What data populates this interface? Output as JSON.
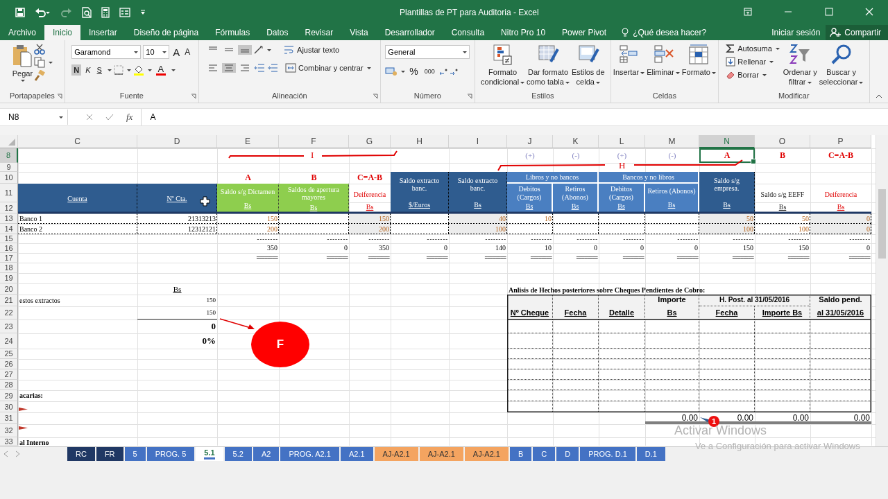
{
  "window": {
    "title": "Plantillas de PT para Auditoria - Excel"
  },
  "menu": {
    "tabs": [
      {
        "label": "Archivo",
        "selected": false
      },
      {
        "label": "Inicio",
        "selected": true
      },
      {
        "label": "Insertar",
        "selected": false
      },
      {
        "label": "Diseño de página",
        "selected": false
      },
      {
        "label": "Fórmulas",
        "selected": false
      },
      {
        "label": "Datos",
        "selected": false
      },
      {
        "label": "Revisar",
        "selected": false
      },
      {
        "label": "Vista",
        "selected": false
      },
      {
        "label": "Desarrollador",
        "selected": false
      },
      {
        "label": "Consulta",
        "selected": false
      },
      {
        "label": "Nitro Pro 10",
        "selected": false
      },
      {
        "label": "Power Pivot",
        "selected": false
      }
    ],
    "tell_me": "¿Qué desea hacer?",
    "sign_in": "Iniciar sesión",
    "share": "Compartir"
  },
  "ribbon": {
    "groups": [
      {
        "kind": "clipboard",
        "label": "Portapapeles",
        "paste": "Pegar"
      },
      {
        "kind": "font",
        "label": "Fuente",
        "font": "Garamond",
        "size": "10",
        "grow": "A",
        "shrink": "A",
        "font_color_label": "A",
        "toggles": [
          {
            "label": "N",
            "on": true
          },
          {
            "label": "K",
            "on": false
          },
          {
            "label": "S",
            "on": false
          }
        ]
      },
      {
        "kind": "alignment",
        "label": "Alineación",
        "wrap": "Ajustar texto",
        "merge": "Combinar y centrar",
        "vertical": [
          {
            "on": false
          },
          {
            "on": false
          },
          {
            "on": true
          }
        ],
        "horizontal": [
          {
            "on": false
          },
          {
            "on": true
          },
          {
            "on": false
          }
        ]
      },
      {
        "kind": "number",
        "label": "Número",
        "format": "General",
        "percent": "%",
        "thousands": "000"
      },
      {
        "kind": "large",
        "label": "Estilos",
        "buttons": [
          {
            "lines": [
              "Formato",
              "condicional"
            ]
          },
          {
            "lines": [
              "Dar formato",
              "como tabla"
            ]
          },
          {
            "lines": [
              "Estilos de",
              "celda"
            ]
          }
        ]
      },
      {
        "kind": "large",
        "label": "Celdas",
        "buttons": [
          {
            "lines": [
              "Insertar"
            ]
          },
          {
            "lines": [
              "Eliminar"
            ]
          },
          {
            "lines": [
              "Formato"
            ]
          }
        ]
      },
      {
        "kind": "editing",
        "label": "Modificar",
        "small": [
          "Autosuma",
          "Rellenar",
          "Borrar"
        ],
        "buttons": [
          {
            "lines": [
              "Ordenar y",
              "filtrar"
            ]
          },
          {
            "lines": [
              "Buscar y",
              "seleccionar"
            ]
          }
        ]
      }
    ]
  },
  "formula_bar": {
    "name_box": "N8",
    "fx": "fx",
    "value": "A"
  },
  "sheet": {
    "columns": [
      {
        "label": "C",
        "selected": false
      },
      {
        "label": "D",
        "selected": false
      },
      {
        "label": "E",
        "selected": false
      },
      {
        "label": "F",
        "selected": false
      },
      {
        "label": "G",
        "selected": false
      },
      {
        "label": "H",
        "selected": false
      },
      {
        "label": "I",
        "selected": false
      },
      {
        "label": "J",
        "selected": false
      },
      {
        "label": "K",
        "selected": false
      },
      {
        "label": "L",
        "selected": false
      },
      {
        "label": "M",
        "selected": false
      },
      {
        "label": "N",
        "selected": true
      },
      {
        "label": "O",
        "selected": false
      },
      {
        "label": "P",
        "selected": false
      }
    ],
    "rows": [
      {
        "number": "8",
        "selected": true,
        "cells": [
          null,
          null,
          null,
          null,
          null,
          null,
          null,
          {
            "kind": "sign",
            "text": "(+)"
          },
          {
            "kind": "sign",
            "text": "(-)"
          },
          {
            "kind": "sign",
            "text": "(+)"
          },
          {
            "kind": "sign",
            "text": "(-)"
          },
          {
            "kind": "red-title",
            "text": "A"
          },
          {
            "kind": "red-title",
            "text": "B"
          },
          {
            "kind": "red-title",
            "text": "C=A-B"
          }
        ]
      },
      {
        "number": "9",
        "selected": false
      },
      {
        "number": "10",
        "selected": false,
        "cells": [
          null,
          null,
          {
            "kind": "red-title",
            "text": "A"
          },
          {
            "kind": "red-title",
            "text": "B"
          },
          {
            "kind": "red-title",
            "text": "C=A-B"
          },
          {
            "kind": "hdr",
            "text": "Saldo extracto banc.",
            "unit": "$/Euros"
          },
          {
            "kind": "hdr",
            "text": "Saldo extracto banc.",
            "unit": "Bs"
          },
          {
            "kind": "hdr-light",
            "text": "Libros y no bancos"
          },
          {
            "kind": "merged-left"
          },
          {
            "kind": "hdr-light",
            "text": "Bancos y no libros"
          },
          {
            "kind": "merged-left"
          },
          {
            "kind": "hdr",
            "text": "Saldo s/g empresa.",
            "unit": "Bs"
          }
        ]
      },
      {
        "number": "11",
        "selected": false,
        "cells": [
          {
            "kind": "hdr",
            "unit": "Cuenta"
          },
          {
            "kind": "hdr",
            "unit": "Nº Cta."
          },
          {
            "kind": "hdr-green",
            "text": "Saldo s/g Dictamen",
            "unit": "Bs"
          },
          {
            "kind": "hdr-green",
            "text": "Saldos de apertura mayores",
            "unit": "Bs"
          },
          {
            "kind": "red-sub",
            "text": "Deiferencia",
            "unit": "Bs"
          },
          {
            "kind": "merged-up"
          },
          {
            "kind": "merged-up"
          },
          {
            "kind": "hdr-light",
            "text": "Debitos (Cargos)",
            "unit": "Bs"
          },
          {
            "kind": "hdr-light",
            "text": "Retiros (Abonos)",
            "unit": "Bs"
          },
          {
            "kind": "hdr-light",
            "text": "Debitos (Cargos)",
            "unit": "Bs"
          },
          {
            "kind": "hdr-light",
            "text": "Retiros (Abonos)",
            "unit": "Bs"
          },
          {
            "kind": "merged-up"
          },
          {
            "kind": "plain-sub",
            "text": "Saldo s/g EEFF",
            "unit": "Bs"
          },
          {
            "kind": "red-sub",
            "text": "Deiferencia",
            "unit": "Bs"
          }
        ]
      },
      {
        "number": "12",
        "selected": false,
        "cells": [
          {
            "kind": "merged-up"
          },
          {
            "kind": "merged-up"
          },
          {
            "kind": "merged-up"
          },
          {
            "kind": "merged-up"
          },
          {
            "kind": "merged-up"
          },
          {
            "kind": "merged-up"
          },
          {
            "kind": "merged-up"
          },
          {
            "kind": "merged-up"
          },
          {
            "kind": "merged-up"
          },
          {
            "kind": "merged-up"
          },
          {
            "kind": "merged-up"
          },
          {
            "kind": "merged-up"
          },
          {
            "kind": "merged-up"
          },
          {
            "kind": "merged-up"
          }
        ]
      },
      {
        "number": "13",
        "selected": false,
        "cells": [
          {
            "kind": "entry",
            "text": "Banco 1"
          },
          {
            "kind": "entry-num",
            "text": "21313213"
          },
          {
            "kind": "entry-amount",
            "text": "150"
          },
          null,
          {
            "kind": "entry-shaded",
            "text": "150"
          },
          null,
          {
            "kind": "entry-shaded",
            "text": "40"
          },
          {
            "kind": "entry-amount",
            "text": "10"
          },
          null,
          null,
          null,
          {
            "kind": "entry-shaded",
            "text": "50"
          },
          {
            "kind": "entry-amount",
            "text": "50"
          },
          {
            "kind": "entry-shaded",
            "text": "0"
          }
        ]
      },
      {
        "number": "14",
        "selected": false,
        "cells": [
          {
            "kind": "entry",
            "text": "Banco 2"
          },
          {
            "kind": "entry-num",
            "text": "12312121"
          },
          {
            "kind": "entry-amount",
            "text": "200"
          },
          null,
          {
            "kind": "entry-shaded",
            "text": "200"
          },
          null,
          {
            "kind": "entry-shaded",
            "text": "100"
          },
          null,
          null,
          null,
          null,
          {
            "kind": "entry-shaded",
            "text": "100"
          },
          {
            "kind": "entry-amount",
            "text": "100"
          },
          {
            "kind": "entry-shaded",
            "text": "0"
          }
        ]
      },
      {
        "number": "15",
        "selected": false,
        "cells": [
          null,
          null,
          {
            "kind": "rule",
            "text": "--------"
          },
          {
            "kind": "rule",
            "text": "--------"
          },
          {
            "kind": "rule",
            "text": "--------"
          },
          {
            "kind": "rule",
            "text": "--------"
          },
          {
            "kind": "rule",
            "text": "--------"
          },
          {
            "kind": "rule",
            "text": "--------"
          },
          {
            "kind": "rule",
            "text": "--------"
          },
          {
            "kind": "rule",
            "text": "--------"
          },
          {
            "kind": "rule",
            "text": "--------"
          },
          {
            "kind": "rule",
            "text": "--------"
          },
          {
            "kind": "rule",
            "text": "--------"
          },
          {
            "kind": "rule",
            "text": "--------"
          }
        ]
      },
      {
        "number": "16",
        "selected": false,
        "cells": [
          null,
          null,
          {
            "kind": "sum",
            "text": "350"
          },
          {
            "kind": "sum",
            "text": "0"
          },
          {
            "kind": "sum",
            "text": "350"
          },
          {
            "kind": "sum",
            "text": "0"
          },
          {
            "kind": "sum",
            "text": "140"
          },
          {
            "kind": "sum",
            "text": "10"
          },
          {
            "kind": "sum",
            "text": "0"
          },
          {
            "kind": "sum",
            "text": "0"
          },
          {
            "kind": "sum",
            "text": "0"
          },
          {
            "kind": "sum",
            "text": "150"
          },
          {
            "kind": "sum",
            "text": "150"
          },
          {
            "kind": "sum",
            "text": "0"
          }
        ]
      },
      {
        "number": "17",
        "selected": false,
        "cells": [
          null,
          null,
          {
            "kind": "rule",
            "text": "========"
          },
          {
            "kind": "rule",
            "text": "========"
          },
          {
            "kind": "rule",
            "text": "========"
          },
          {
            "kind": "rule",
            "text": "========"
          },
          {
            "kind": "rule",
            "text": "========"
          },
          {
            "kind": "rule",
            "text": "========"
          },
          {
            "kind": "rule",
            "text": "========"
          },
          {
            "kind": "rule",
            "text": "========"
          },
          {
            "kind": "rule",
            "text": "========"
          },
          {
            "kind": "rule",
            "text": "========"
          },
          {
            "kind": "rule",
            "text": "========"
          },
          {
            "kind": "rule",
            "text": "========"
          }
        ]
      },
      {
        "number": "18",
        "selected": false
      },
      {
        "number": "19",
        "selected": false
      },
      {
        "number": "20",
        "selected": false,
        "cells": [
          null,
          {
            "kind": "unit",
            "unit": "Bs"
          },
          null,
          null,
          null,
          null,
          null,
          {
            "kind": "caption",
            "text": "Anlisis de Hechos posteriores sobre Cheques Pendientes de Cobro:"
          }
        ]
      },
      {
        "number": "21",
        "selected": false,
        "cells": [
          {
            "kind": "text",
            "text": "estos extractos"
          },
          {
            "kind": "small-num",
            "text": "150"
          },
          null,
          null,
          null,
          null,
          null,
          {
            "kind": "th",
            "unit": "Nº Cheque"
          },
          {
            "kind": "th",
            "unit": "Fecha"
          },
          {
            "kind": "th",
            "unit": "Detalle"
          },
          {
            "kind": "th",
            "text": "Importe",
            "unit": "Bs"
          },
          {
            "kind": "th-group",
            "text": "H. Post. al 31/05/2016"
          },
          {
            "kind": "merged-left"
          },
          {
            "kind": "th",
            "text": "Saldo pend.",
            "unit": "al 31/05/2016"
          }
        ]
      },
      {
        "number": "22",
        "selected": false,
        "cells": [
          null,
          {
            "kind": "small-num-line",
            "text": "150"
          },
          null,
          null,
          null,
          null,
          null,
          {
            "kind": "merged-up"
          },
          {
            "kind": "merged-up"
          },
          {
            "kind": "merged-up"
          },
          {
            "kind": "merged-up"
          },
          {
            "kind": "th",
            "unit": "Fecha"
          },
          {
            "kind": "th",
            "unit": "Importe Bs"
          },
          {
            "kind": "merged-up"
          }
        ]
      },
      {
        "number": "23",
        "selected": false,
        "cells": [
          null,
          {
            "kind": "big",
            "text": "0"
          }
        ]
      },
      {
        "number": "24",
        "selected": false,
        "cells": [
          null,
          {
            "kind": "big",
            "text": "0%"
          }
        ]
      },
      {
        "number": "25",
        "selected": false
      },
      {
        "number": "26",
        "selected": false
      },
      {
        "number": "27",
        "selected": false
      },
      {
        "number": "28",
        "selected": false
      },
      {
        "number": "29",
        "selected": false,
        "cells": [
          {
            "kind": "bold",
            "text": "acarias:"
          }
        ]
      },
      {
        "number": "30",
        "selected": false
      },
      {
        "number": "31",
        "selected": false,
        "cells": [
          null,
          null,
          null,
          null,
          null,
          null,
          null,
          null,
          null,
          null,
          {
            "kind": "total",
            "text": "0.00"
          },
          {
            "kind": "total",
            "text": "0.00"
          },
          {
            "kind": "total",
            "text": "0.00"
          },
          {
            "kind": "total",
            "text": "0.00"
          }
        ]
      },
      {
        "number": "32",
        "selected": false
      },
      {
        "number": "33",
        "selected": false,
        "cells": [
          {
            "kind": "bold",
            "text": "al Interno"
          }
        ]
      }
    ],
    "annotations": [
      {
        "kind": "bracket",
        "label": "I"
      },
      {
        "kind": "bracket",
        "label": "H"
      },
      {
        "kind": "arrow"
      },
      {
        "kind": "bubble",
        "label": "F"
      },
      {
        "kind": "badge",
        "label": "1"
      },
      {
        "kind": "marker"
      },
      {
        "kind": "marker"
      },
      {
        "kind": "cursor"
      }
    ]
  },
  "sheet_tabs": [
    {
      "label": "RC",
      "color": "#203864",
      "selected": false
    },
    {
      "label": "FR",
      "color": "#203864",
      "selected": false
    },
    {
      "label": "5",
      "color": "#4472c4",
      "selected": false
    },
    {
      "label": "PROG. 5",
      "color": "#4472c4",
      "selected": false
    },
    {
      "label": "5.1",
      "color": "#4472c4",
      "selected": true
    },
    {
      "label": "5.2",
      "color": "#4472c4",
      "selected": false
    },
    {
      "label": "A2",
      "color": "#4472c4",
      "selected": false
    },
    {
      "label": "PROG. A2.1",
      "color": "#4472c4",
      "selected": false
    },
    {
      "label": "A2.1",
      "color": "#4472c4",
      "selected": false
    },
    {
      "label": "AJ-A2.1",
      "color": "#f4a460",
      "selected": false
    },
    {
      "label": "AJ-A2.1",
      "color": "#f4a460",
      "selected": false
    },
    {
      "label": "AJ-A2.1",
      "color": "#f4a460",
      "selected": false
    },
    {
      "label": "B",
      "color": "#4472c4",
      "selected": false
    },
    {
      "label": "C",
      "color": "#4472c4",
      "selected": false
    },
    {
      "label": "D",
      "color": "#4472c4",
      "selected": false
    },
    {
      "label": "PROG. D.1",
      "color": "#4472c4",
      "selected": false
    },
    {
      "label": "D.1",
      "color": "#4472c4",
      "selected": false
    }
  ],
  "activation": {
    "title": "Activar Windows",
    "hint": "Ve a Configuración para activar Windows"
  }
}
